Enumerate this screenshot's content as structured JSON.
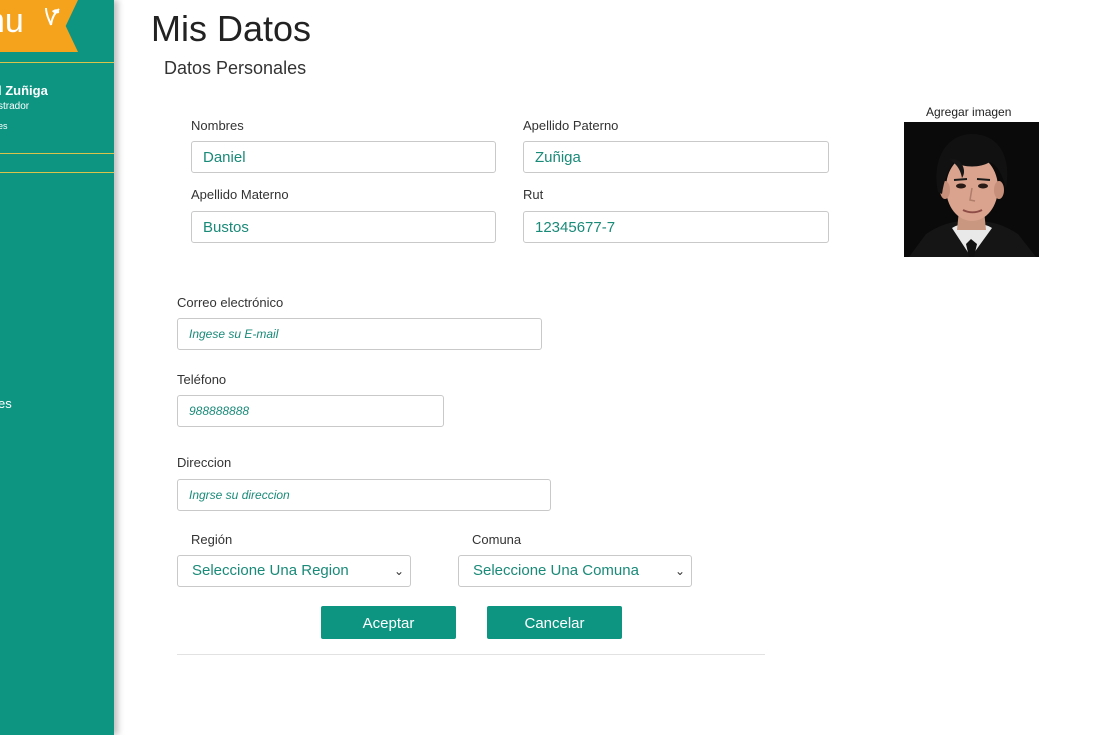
{
  "sidebar": {
    "logo_text": "nu",
    "user_name": "l Zuñiga",
    "user_role": "strador",
    "user_extra": "es",
    "items": [
      {
        "label": "l"
      },
      {
        "label": "es"
      }
    ],
    "bg_color": "#0e9582",
    "accent_color": "#f5a21c"
  },
  "page": {
    "title": "Mis Datos",
    "section": "Datos Personales"
  },
  "form": {
    "nombres": {
      "label": "Nombres",
      "value": "Daniel"
    },
    "apellido_paterno": {
      "label": "Apellido Paterno",
      "value": "Zuñiga"
    },
    "apellido_materno": {
      "label": "Apellido Materno",
      "value": "Bustos"
    },
    "rut": {
      "label": "Rut",
      "value": "12345677-7"
    },
    "correo": {
      "label": "Correo electrónico",
      "placeholder": "Ingese su E-mail"
    },
    "telefono": {
      "label": "Teléfono",
      "placeholder": "988888888"
    },
    "direccion": {
      "label": "Direccion",
      "placeholder": "Ingrse su direccion"
    },
    "region": {
      "label": "Región",
      "selected": "Seleccione Una Region"
    },
    "comuna": {
      "label": "Comuna",
      "selected": "Seleccione Una Comuna"
    }
  },
  "buttons": {
    "accept": "Aceptar",
    "cancel": "Cancelar"
  },
  "image": {
    "label": "Agregar imagen"
  }
}
